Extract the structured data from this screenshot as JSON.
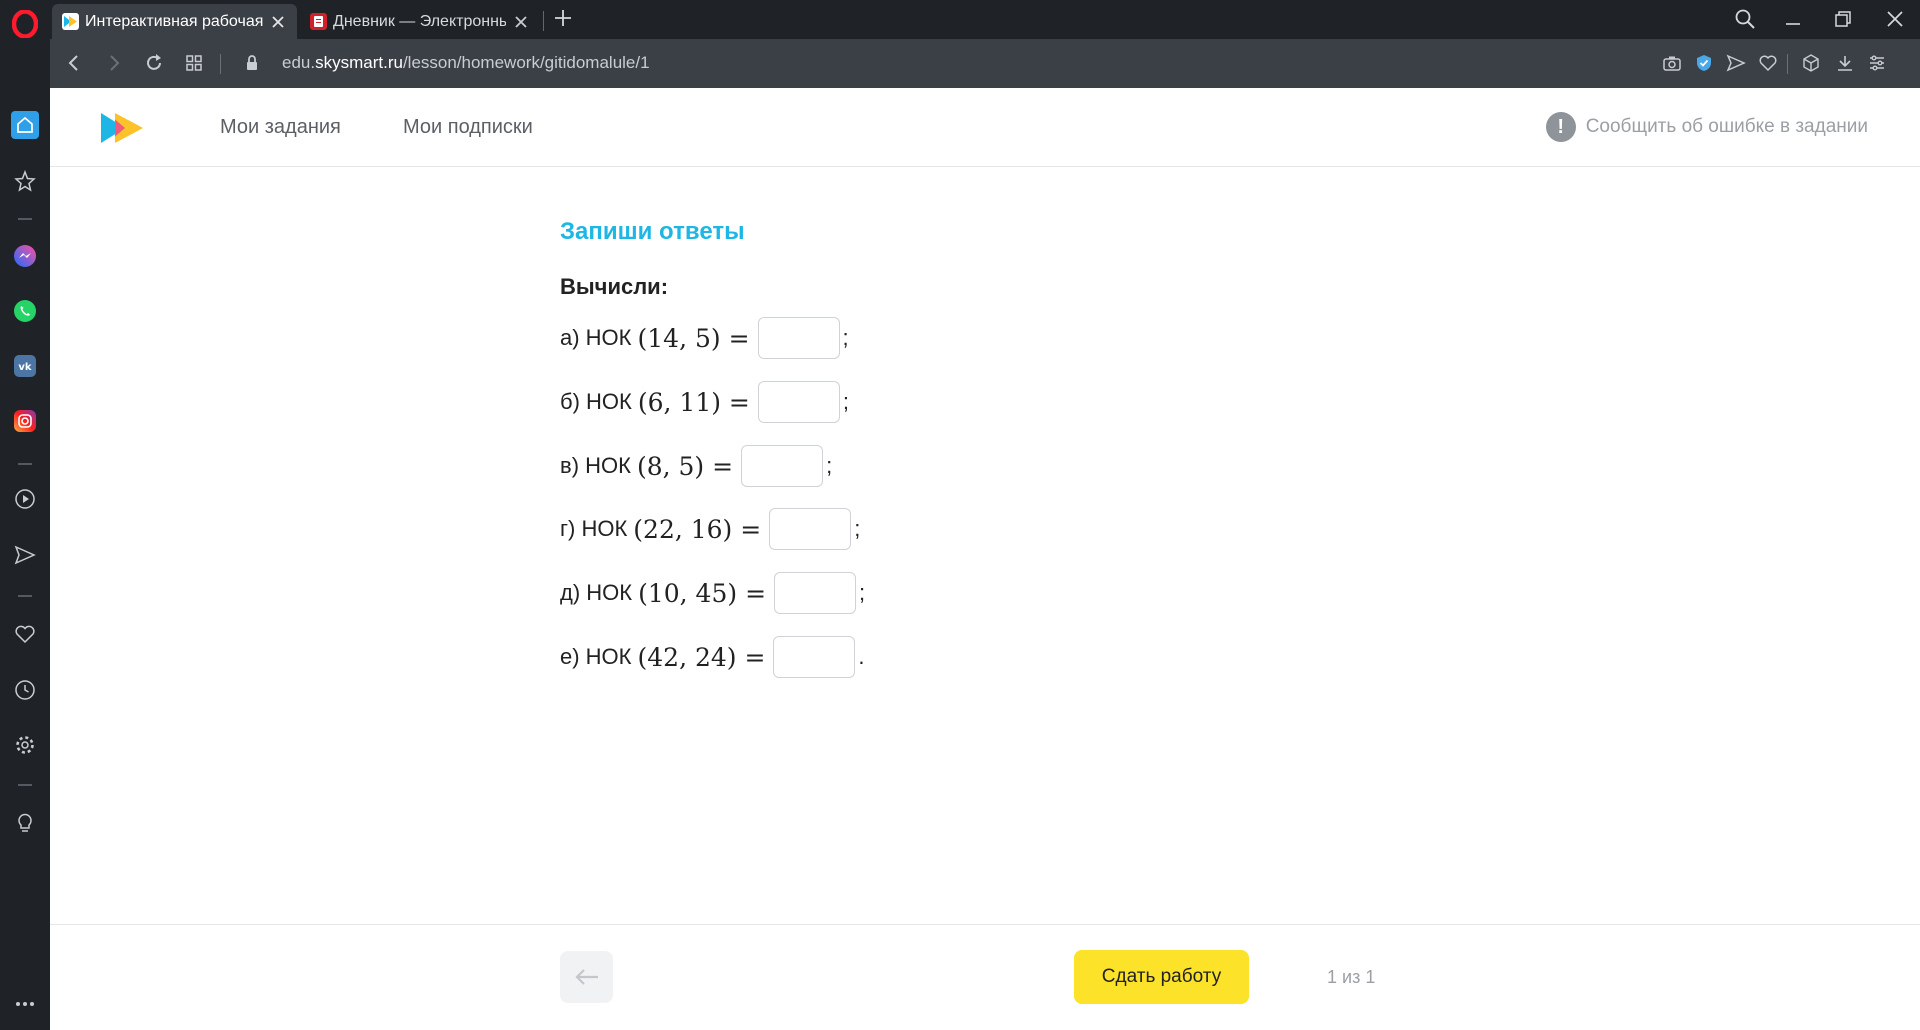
{
  "browser": {
    "tabs": [
      {
        "title": "Интерактивная рабочая т",
        "active": true
      },
      {
        "title": "Дневник — Электронный",
        "active": false
      }
    ],
    "url": {
      "prefix": "edu.",
      "domain": "skysmart.ru",
      "path": "/lesson/homework/gitidomalule/1"
    }
  },
  "header": {
    "nav": [
      "Мои задания",
      "Мои подписки"
    ],
    "report_error": "Сообщить об ошибке в задании"
  },
  "task": {
    "title": "Запиши ответы",
    "instruction": "Вычисли:",
    "exercises": [
      {
        "prefix": "а) НОК",
        "expr": "(14, 5) =",
        "end": ";"
      },
      {
        "prefix": "б) НОК",
        "expr": "(6, 11) =",
        "end": ";"
      },
      {
        "prefix": "в) НОК",
        "expr": "(8, 5) =",
        "end": ";"
      },
      {
        "prefix": "г) НОК",
        "expr": "(22, 16) =",
        "end": ";"
      },
      {
        "prefix": "д) НОК",
        "expr": "(10, 45) =",
        "end": ";"
      },
      {
        "prefix": "е) НОК",
        "expr": "(42, 24) =",
        "end": "."
      }
    ]
  },
  "footer": {
    "submit_label": "Сдать работу",
    "page_counter": "1 из 1"
  },
  "colors": {
    "accent_title": "#1eb6e4",
    "submit_button": "#fce229",
    "chrome_dark": "#1f2227",
    "chrome_mid": "#3b3f46"
  },
  "icons": {
    "sidebar": [
      "home-icon",
      "star-icon",
      "messenger-icon",
      "whatsapp-icon",
      "vk-icon",
      "instagram-icon",
      "player-icon",
      "send-icon",
      "heart-icon",
      "history-icon",
      "settings-icon",
      "bulb-icon",
      "more-icon"
    ],
    "addressbar": [
      "camera-icon",
      "shield-icon",
      "send-icon",
      "heart-icon",
      "box-icon",
      "download-icon",
      "easy-setup-icon"
    ]
  }
}
